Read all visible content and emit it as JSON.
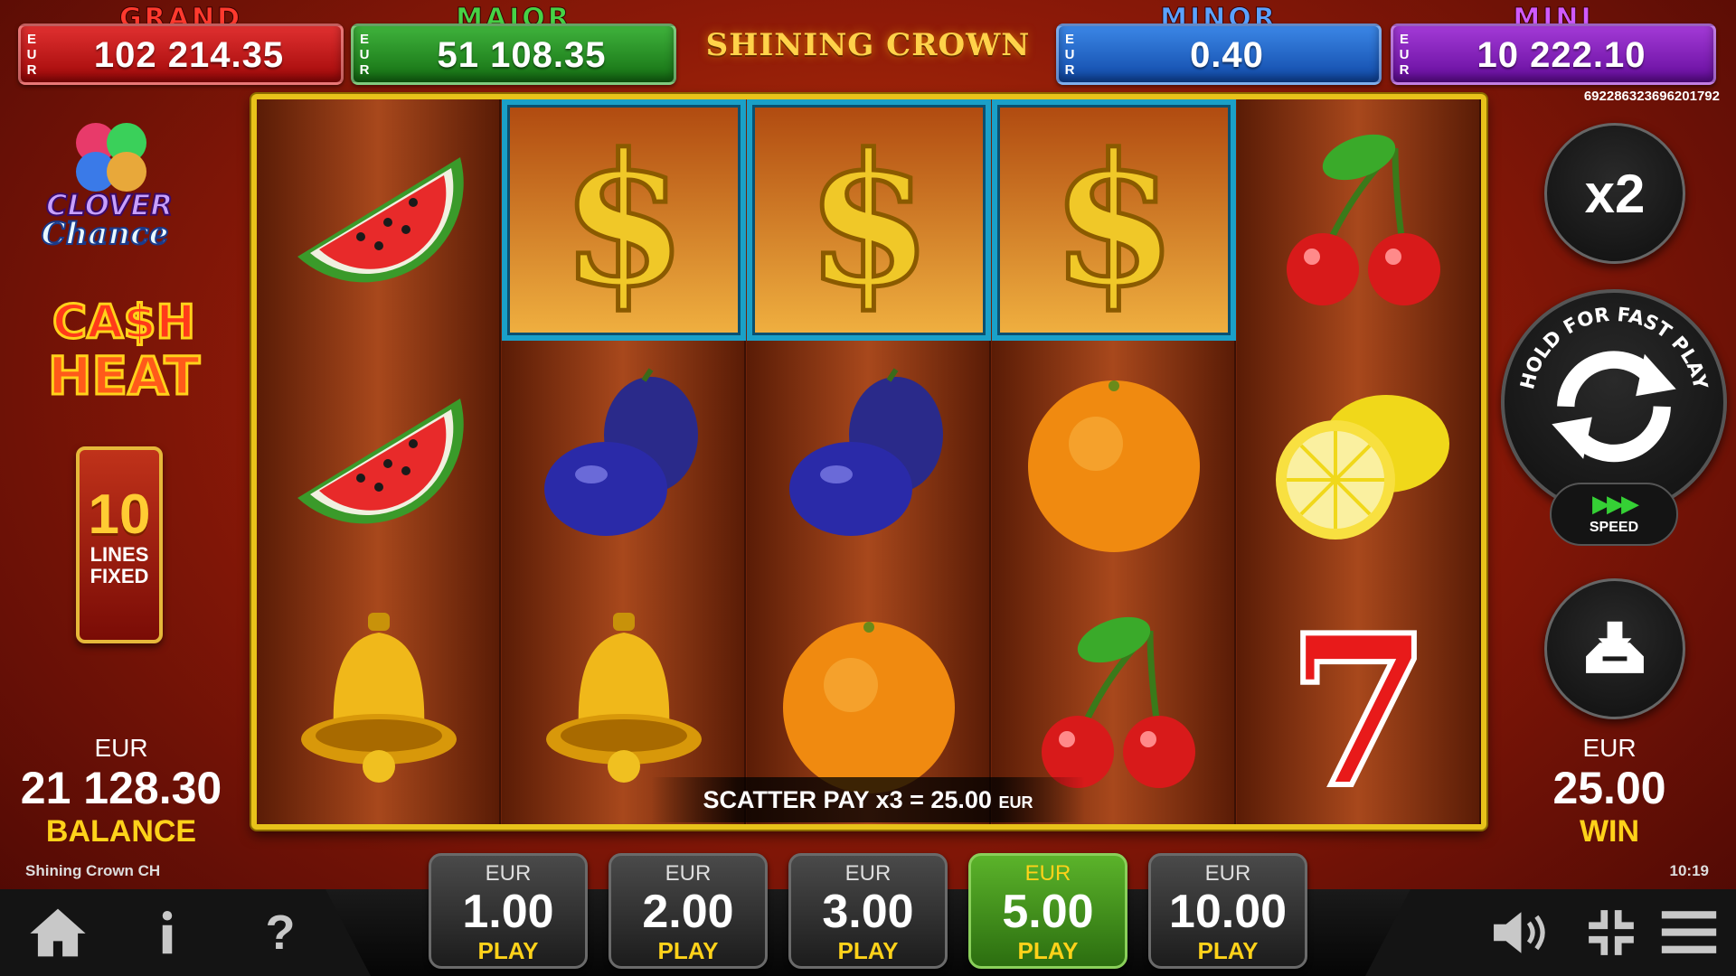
{
  "jackpots": {
    "grand": {
      "title": "GRAND",
      "currency": "E U R",
      "value": "102 214.35"
    },
    "major": {
      "title": "MAJOR",
      "currency": "E U R",
      "value": "51 108.35"
    },
    "minor": {
      "title": "MINOR",
      "currency": "E U R",
      "value": "0.40"
    },
    "mini": {
      "title": "MINI",
      "currency": "E U R",
      "value": "10 222.10"
    }
  },
  "game_title": "SHINING CROWN",
  "round_id": "6922863236962017​92",
  "left_panel": {
    "clover_logo_text": "CLOVER Chance",
    "cash_heat_text": "CA$H HEAT",
    "lines_number": "10",
    "lines_label_1": "LINES",
    "lines_label_2": "FIXED",
    "balance_currency": "EUR",
    "balance_value": "21 128.30",
    "balance_label": "BALANCE",
    "game_name": "Shining Crown CH"
  },
  "right_panel": {
    "multiplier_label": "x2",
    "spin_ring_text": "HOLD FOR FAST PLAY",
    "speed_label": "SPEED",
    "win_currency": "EUR",
    "win_value": "25.00",
    "win_label": "WIN",
    "clock": "10:19"
  },
  "reels": [
    [
      "watermelon",
      "watermelon",
      "bell"
    ],
    [
      "dollar",
      "plum",
      "bell"
    ],
    [
      "dollar",
      "plum",
      "orange"
    ],
    [
      "dollar",
      "orange",
      "cherry"
    ],
    [
      "cherry",
      "lemon",
      "seven"
    ]
  ],
  "winning_cells": [
    [
      1,
      0
    ],
    [
      2,
      0
    ],
    [
      3,
      0
    ]
  ],
  "scatter_message": {
    "text": "SCATTER PAY  x3 = 25.00",
    "currency": "EUR"
  },
  "bets": [
    {
      "currency": "EUR",
      "value": "1.00",
      "label": "PLAY",
      "active": false
    },
    {
      "currency": "EUR",
      "value": "2.00",
      "label": "PLAY",
      "active": false
    },
    {
      "currency": "EUR",
      "value": "3.00",
      "label": "PLAY",
      "active": false
    },
    {
      "currency": "EUR",
      "value": "5.00",
      "label": "PLAY",
      "active": true
    },
    {
      "currency": "EUR",
      "value": "10.00",
      "label": "PLAY",
      "active": false
    }
  ],
  "bottom_icons": [
    "home-icon",
    "info-icon",
    "help-icon",
    "sound-icon",
    "fullscreen-icon",
    "menu-icon"
  ],
  "colors": {
    "grand": "#c81818",
    "major": "#2a9a28",
    "minor": "#2a6ad0",
    "mini": "#8420c0",
    "reel_frame": "#e8c21a",
    "win_highlight": "#1aa0c8",
    "active_bet": "#4aa020",
    "accent_yellow": "#ffd21a"
  }
}
